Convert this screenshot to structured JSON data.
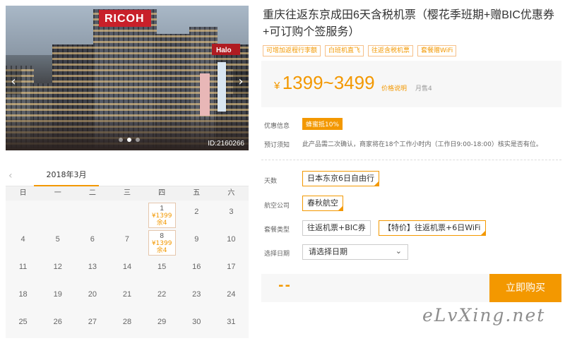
{
  "photo": {
    "id_label": "ID:2160266",
    "sign_text": "RICOH",
    "side_sign_text": "Halo",
    "prev_icon": "chevron-left-icon",
    "next_icon": "chevron-right-icon"
  },
  "calendar": {
    "prev_icon": "chevron-left-icon",
    "month": "2018年3月",
    "weekdays": [
      "日",
      "一",
      "二",
      "三",
      "四",
      "五",
      "六"
    ],
    "days": [
      {
        "d": "",
        "price": "",
        "stock": ""
      },
      {
        "d": "",
        "price": "",
        "stock": ""
      },
      {
        "d": "",
        "price": "",
        "stock": ""
      },
      {
        "d": "",
        "price": "",
        "stock": ""
      },
      {
        "d": "1",
        "price": "¥1399",
        "stock": "余4"
      },
      {
        "d": "2",
        "price": "",
        "stock": ""
      },
      {
        "d": "3",
        "price": "",
        "stock": ""
      },
      {
        "d": "4",
        "price": "",
        "stock": ""
      },
      {
        "d": "5",
        "price": "",
        "stock": ""
      },
      {
        "d": "6",
        "price": "",
        "stock": ""
      },
      {
        "d": "7",
        "price": "",
        "stock": ""
      },
      {
        "d": "8",
        "price": "¥1399",
        "stock": "余4"
      },
      {
        "d": "9",
        "price": "",
        "stock": ""
      },
      {
        "d": "10",
        "price": "",
        "stock": ""
      },
      {
        "d": "11",
        "price": "",
        "stock": ""
      },
      {
        "d": "12",
        "price": "",
        "stock": ""
      },
      {
        "d": "13",
        "price": "",
        "stock": ""
      },
      {
        "d": "14",
        "price": "",
        "stock": ""
      },
      {
        "d": "15",
        "price": "",
        "stock": ""
      },
      {
        "d": "16",
        "price": "",
        "stock": ""
      },
      {
        "d": "17",
        "price": "",
        "stock": ""
      },
      {
        "d": "18",
        "price": "",
        "stock": ""
      },
      {
        "d": "19",
        "price": "",
        "stock": ""
      },
      {
        "d": "20",
        "price": "",
        "stock": ""
      },
      {
        "d": "21",
        "price": "",
        "stock": ""
      },
      {
        "d": "22",
        "price": "",
        "stock": ""
      },
      {
        "d": "23",
        "price": "",
        "stock": ""
      },
      {
        "d": "24",
        "price": "",
        "stock": ""
      },
      {
        "d": "25",
        "price": "",
        "stock": ""
      },
      {
        "d": "26",
        "price": "",
        "stock": ""
      },
      {
        "d": "27",
        "price": "",
        "stock": ""
      },
      {
        "d": "28",
        "price": "",
        "stock": ""
      },
      {
        "d": "29",
        "price": "",
        "stock": ""
      },
      {
        "d": "30",
        "price": "",
        "stock": ""
      },
      {
        "d": "31",
        "price": "",
        "stock": ""
      }
    ]
  },
  "product": {
    "title": "重庆往返东京成田6天含税机票（樱花季班期+赠BIC优惠券+可订购个签服务）",
    "tags": [
      "可增加返程行李额",
      "白班机直飞",
      "往返含税机票",
      "套餐赠WiFi"
    ],
    "price_currency": "¥",
    "price_range": "1399~3499",
    "price_note": "价格说明",
    "monthly_sales": "月售4"
  },
  "info": {
    "promo_label": "优惠信息",
    "promo_badge": "蜂蜜抵10%",
    "notice_label": "预订须知",
    "notice_text": "此产品需二次确认，商家将在18个工作小时内（工作日9:00-18:00）核实是否有位。"
  },
  "options": {
    "days_label": "天数",
    "days_value": "日本东京6日自由行",
    "airline_label": "航空公司",
    "airline_value": "春秋航空",
    "package_label": "套餐类型",
    "package_options": [
      "往返机票+BIC券",
      "【特价】往返机票+6日WiFi"
    ],
    "date_label": "选择日期",
    "date_placeholder": "请选择日期"
  },
  "buy": {
    "price_placeholder": "--",
    "button_label": "立即购买"
  },
  "watermark": "eLvXing.net",
  "colors": {
    "accent": "#f39800",
    "panel_bg": "#f7f7f7"
  }
}
